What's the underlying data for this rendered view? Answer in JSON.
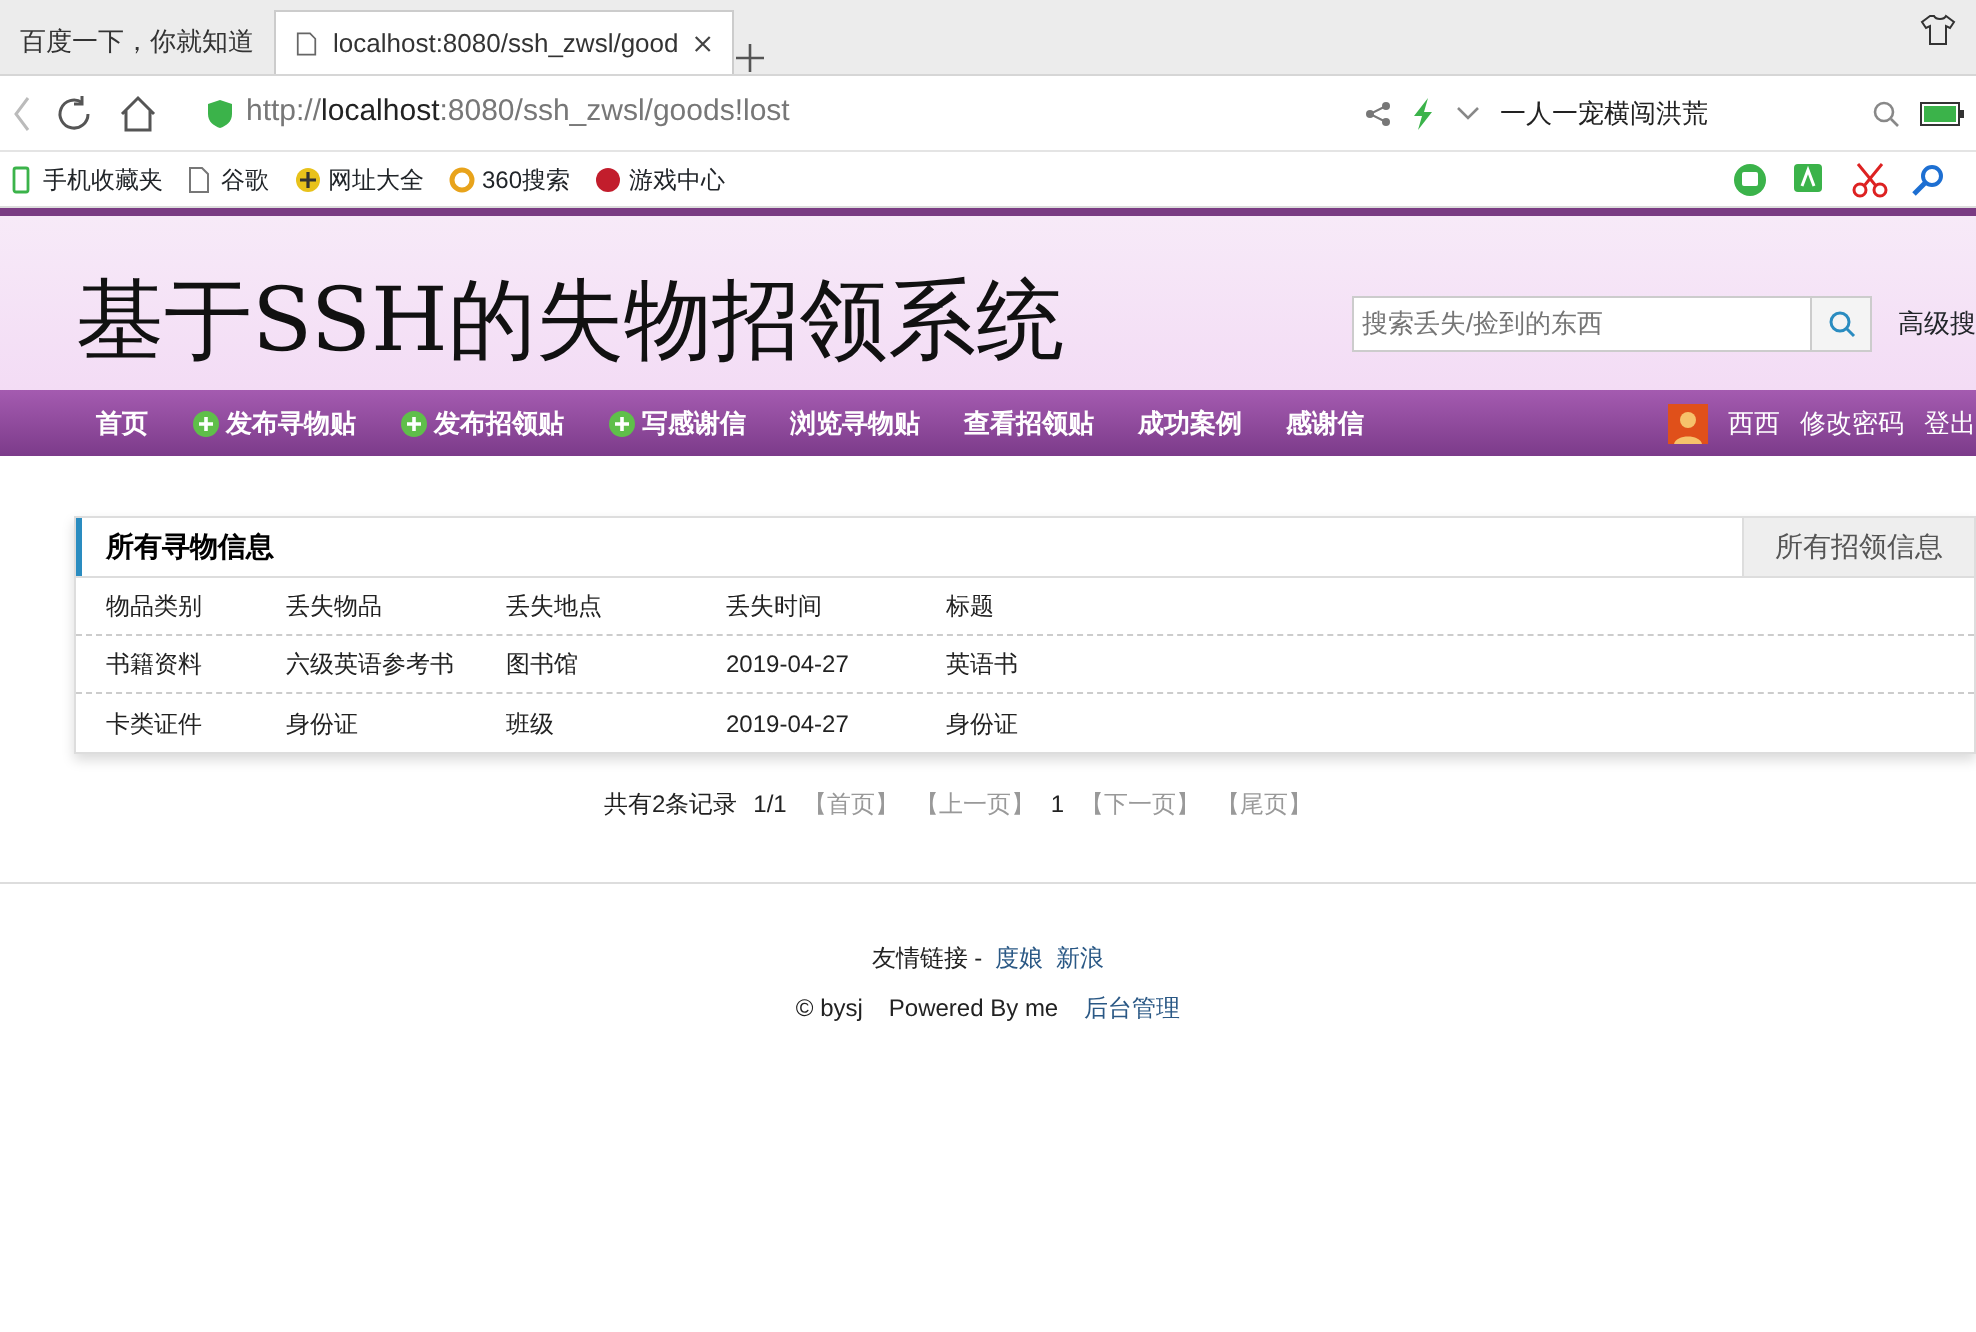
{
  "browser": {
    "tabs": [
      {
        "title": "百度一下，你就知道",
        "selected": false
      },
      {
        "title": "localhost:8080/ssh_zwsl/good",
        "selected": true
      }
    ],
    "address": {
      "scheme": "http://",
      "host": "localhost",
      "rest": ":8080/ssh_zwsl/goods!lost"
    },
    "search_text": "一人一宠横闯洪荒",
    "bookmarks": [
      {
        "label": "手机收藏夹"
      },
      {
        "label": "谷歌"
      },
      {
        "label": "网址大全"
      },
      {
        "label": "360搜索"
      },
      {
        "label": "游戏中心"
      }
    ]
  },
  "header": {
    "title": "基于SSH的失物招领系统",
    "search": {
      "placeholder": "搜索丢失/捡到的东西"
    },
    "advanced_search": "高级搜"
  },
  "nav": {
    "items": [
      {
        "label": "首页",
        "kind": "plain"
      },
      {
        "label": "发布寻物贴",
        "kind": "plus"
      },
      {
        "label": "发布招领贴",
        "kind": "plus"
      },
      {
        "label": "写感谢信",
        "kind": "plus"
      },
      {
        "label": "浏览寻物贴",
        "kind": "plain"
      },
      {
        "label": "查看招领贴",
        "kind": "plain"
      },
      {
        "label": "成功案例",
        "kind": "plain"
      },
      {
        "label": "感谢信",
        "kind": "plain"
      }
    ],
    "user": "西西",
    "links": [
      "修改密码",
      "登出"
    ]
  },
  "panel": {
    "tabs": [
      {
        "label": "所有寻物信息",
        "selected": true
      },
      {
        "label": "所有招领信息",
        "selected": false
      }
    ],
    "columns": [
      "物品类别",
      "丢失物品",
      "丢失地点",
      "丢失时间",
      "标题"
    ],
    "rows": [
      [
        "书籍资料",
        "六级英语参考书",
        "图书馆",
        "2019-04-27",
        "英语书"
      ],
      [
        "卡类证件",
        "身份证",
        "班级",
        "2019-04-27",
        "身份证"
      ]
    ]
  },
  "pagination": {
    "summary": "共有2条记录",
    "page": "1/1",
    "links": [
      {
        "label": "【首页】",
        "disabled": true
      },
      {
        "label": "【上一页】",
        "disabled": true
      },
      {
        "label": "1",
        "disabled": false
      },
      {
        "label": "【下一页】",
        "disabled": true
      },
      {
        "label": "【尾页】",
        "disabled": true
      }
    ]
  },
  "footer": {
    "links_label": "友情链接 -",
    "links": [
      "度娘",
      "新浪"
    ],
    "copyright": "© bysj",
    "powered": "Powered By me",
    "admin_link": "后台管理"
  }
}
